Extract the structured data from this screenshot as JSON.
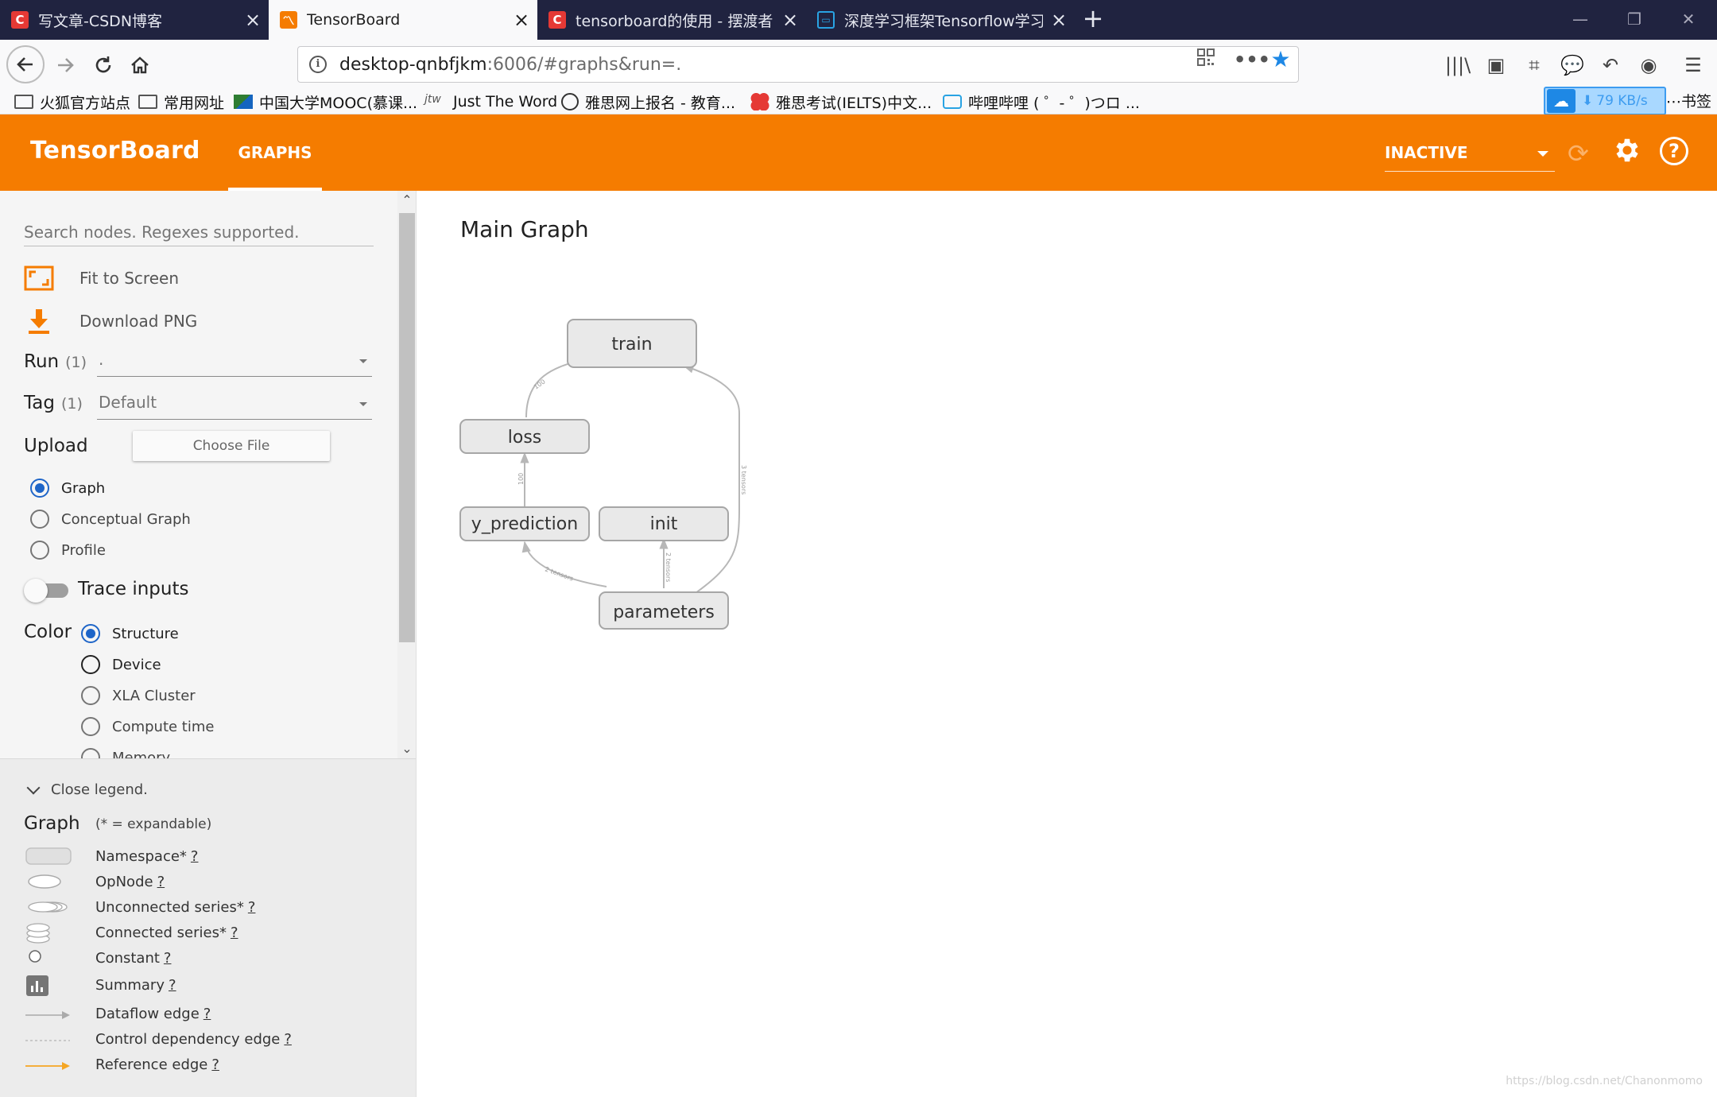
{
  "browser": {
    "tabs": [
      {
        "title": "写文章-CSDN博客",
        "icon": "csdn-icon",
        "active": false
      },
      {
        "title": "TensorBoard",
        "icon": "tensorboard-icon",
        "active": true
      },
      {
        "title": "tensorboard的使用 - 摆渡者",
        "icon": "csdn-icon",
        "active": false
      },
      {
        "title": "深度学习框架Tensorflow学习",
        "icon": "bilibili-icon",
        "active": false
      }
    ],
    "new_tab_label": "+",
    "url_host": "desktop-qnbfjkm",
    "url_rest": ":6006/#graphs&run=.",
    "bookmarks": [
      {
        "label": "火狐官方站点",
        "icon": "folder-icon"
      },
      {
        "label": "常用网址",
        "icon": "folder-icon"
      },
      {
        "label": "中国大学MOOC(慕课...",
        "icon": "mooc-icon"
      },
      {
        "label": "Just The Word",
        "icon": "jtw-icon"
      },
      {
        "label": "雅思网上报名 - 教育...",
        "icon": "globe-icon"
      },
      {
        "label": "雅思考试(IELTS)中文...",
        "icon": "ielts-icon"
      },
      {
        "label": "哔哩哔哩 ( ゜- ゜)つロ ...",
        "icon": "bilibili-icon"
      }
    ],
    "bookmarks_tail": "⋯书签",
    "speed": "79 KB/s"
  },
  "tensorboard": {
    "logo": "TensorBoard",
    "tab": "GRAPHS",
    "run_status": "INACTIVE",
    "accent": "#f57c00"
  },
  "sidebar": {
    "search_placeholder": "Search nodes. Regexes supported.",
    "fit_to_screen": "Fit to Screen",
    "download_png": "Download PNG",
    "run_label": "Run",
    "run_count": "(1)",
    "run_value": ".",
    "tag_label": "Tag",
    "tag_count": "(1)",
    "tag_value": "Default",
    "upload_label": "Upload",
    "choose_file": "Choose File",
    "graph_modes": [
      "Graph",
      "Conceptual Graph",
      "Profile"
    ],
    "selected_graph_mode": "Graph",
    "trace_inputs": "Trace inputs",
    "trace_inputs_on": false,
    "color_label": "Color",
    "color_modes": [
      "Structure",
      "Device",
      "XLA Cluster",
      "Compute time",
      "Memory"
    ],
    "selected_color_mode": "Structure"
  },
  "legend": {
    "toggle": "Close legend.",
    "title": "Graph",
    "note": "(* = expandable)",
    "items": [
      {
        "label": "Namespace*",
        "help": "?",
        "icon": "namespace-icon"
      },
      {
        "label": "OpNode",
        "help": "?",
        "icon": "opnode-icon"
      },
      {
        "label": "Unconnected series*",
        "help": "?",
        "icon": "unconnected-series-icon"
      },
      {
        "label": "Connected series*",
        "help": "?",
        "icon": "connected-series-icon"
      },
      {
        "label": "Constant",
        "help": "?",
        "icon": "constant-icon"
      },
      {
        "label": "Summary",
        "help": "?",
        "icon": "summary-icon"
      },
      {
        "label": "Dataflow edge",
        "help": "?",
        "icon": "dataflow-edge-icon"
      },
      {
        "label": "Control dependency edge",
        "help": "?",
        "icon": "control-edge-icon"
      },
      {
        "label": "Reference edge",
        "help": "?",
        "icon": "reference-edge-icon"
      }
    ]
  },
  "main": {
    "title": "Main Graph",
    "nodes": [
      "train",
      "loss",
      "y_prediction",
      "init",
      "parameters"
    ],
    "edge_labels": [
      "100",
      "100",
      "3 tensors",
      "2 tensors",
      "2 tensors"
    ]
  },
  "watermark": "https://blog.csdn.net/Chanonmomo"
}
